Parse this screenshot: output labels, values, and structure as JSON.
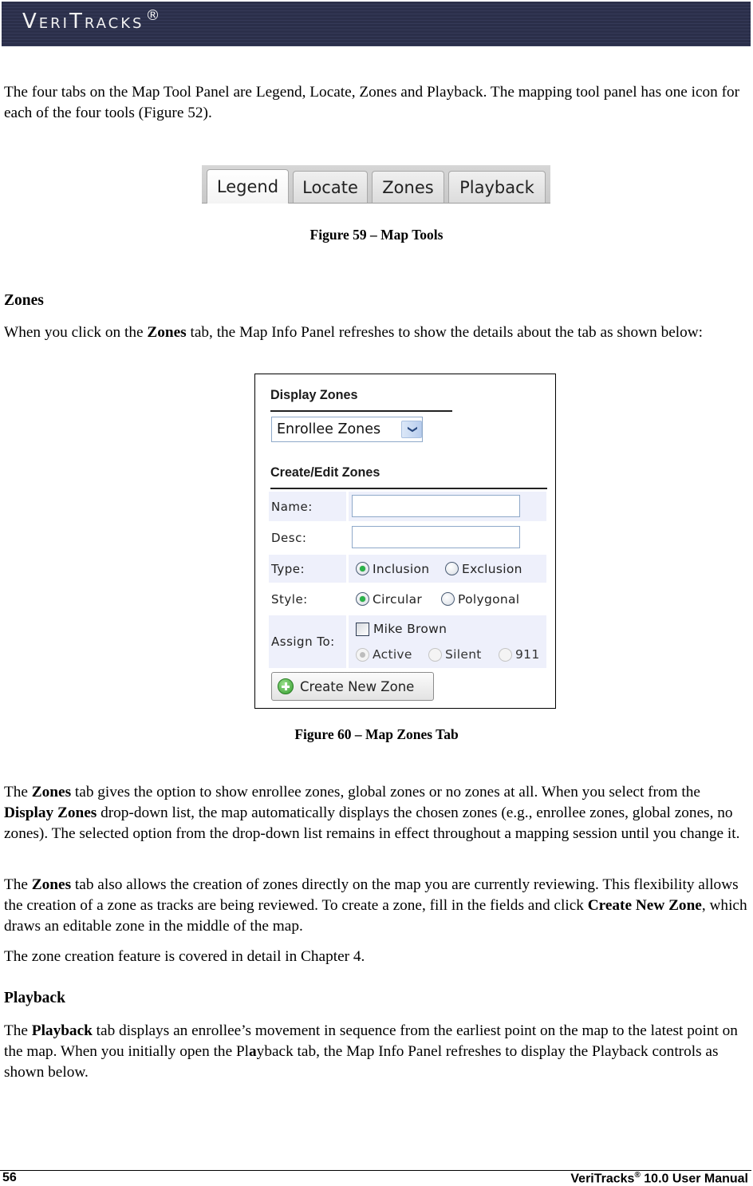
{
  "header": {
    "logo_text": "VeriTracks",
    "logo_mark": "®"
  },
  "intro": {
    "paragraph": "The four tabs on the Map Tool Panel are Legend, Locate, Zones and Playback. The mapping tool panel has one icon for each of the four tools (Figure 52)."
  },
  "map_tools_figure": {
    "tabs": [
      {
        "label": "Legend",
        "active": true
      },
      {
        "label": "Locate",
        "active": false
      },
      {
        "label": "Zones",
        "active": false
      },
      {
        "label": "Playback",
        "active": false
      }
    ],
    "caption": "Figure 59 – Map Tools"
  },
  "zones_section": {
    "heading": "Zones",
    "intro_pre": "When you click on the ",
    "intro_bold": "Zones",
    "intro_post": " tab, the Map Info Panel refreshes to show the details about the tab as shown below:"
  },
  "zones_figure": {
    "display_title": "Display Zones",
    "display_select_value": "Enrollee Zones",
    "create_title": "Create/Edit Zones",
    "name_label": "Name:",
    "name_value": "",
    "desc_label": "Desc:",
    "desc_value": "",
    "type_label": "Type:",
    "type_options": [
      {
        "label": "Inclusion",
        "selected": true
      },
      {
        "label": "Exclusion",
        "selected": false
      }
    ],
    "style_label": "Style:",
    "style_options": [
      {
        "label": "Circular",
        "selected": true
      },
      {
        "label": "Polygonal",
        "selected": false
      }
    ],
    "assign_label": "Assign To:",
    "assign_enrollee": {
      "label": "Mike Brown",
      "checked": false
    },
    "assign_modes": [
      {
        "label": "Active",
        "selected": true,
        "disabled": true
      },
      {
        "label": "Silent",
        "selected": false,
        "disabled": true
      },
      {
        "label": "911",
        "selected": false,
        "disabled": true
      }
    ],
    "create_button": "Create New Zone",
    "caption": "Figure 60 – Map Zones Tab"
  },
  "zones_body": {
    "p1": [
      {
        "t": "The "
      },
      {
        "b": "Zones"
      },
      {
        "t": " tab gives the option to show enrollee zones, global zones or no zones at all. When you select from the "
      },
      {
        "b": "Display Zones"
      },
      {
        "t": " drop-down list, the map automatically displays the chosen zones (e.g., enrollee zones, global zones, no zones). The selected option from the drop-down list remains in effect throughout a mapping session until you change it."
      }
    ],
    "p2": [
      {
        "t": "The "
      },
      {
        "b": "Zones"
      },
      {
        "t": " tab also allows the creation of zones directly on the map you are currently reviewing. This flexibility allows the creation of a zone as tracks are being reviewed. To create a zone, fill in the fields and click "
      },
      {
        "b": "Create New Zone"
      },
      {
        "t": ", which draws an editable zone in the middle of the map."
      }
    ],
    "p3": "The zone creation feature is covered in detail in Chapter 4."
  },
  "playback_section": {
    "heading": "Playback",
    "p1": [
      {
        "t": "The "
      },
      {
        "b": "Playback"
      },
      {
        "t": " tab displays an enrollee’s movement in sequence from the earliest point on the map to the latest point on the map. When you initially open the Pl"
      },
      {
        "b": "a"
      },
      {
        "t": "yback tab, the Map Info Panel refreshes to display the Playback controls as shown below."
      }
    ]
  },
  "footer": {
    "page_number": "56",
    "manual_pre": "VeriTracks",
    "manual_mark": "®",
    "manual_post": " 10.0 User Manual"
  }
}
